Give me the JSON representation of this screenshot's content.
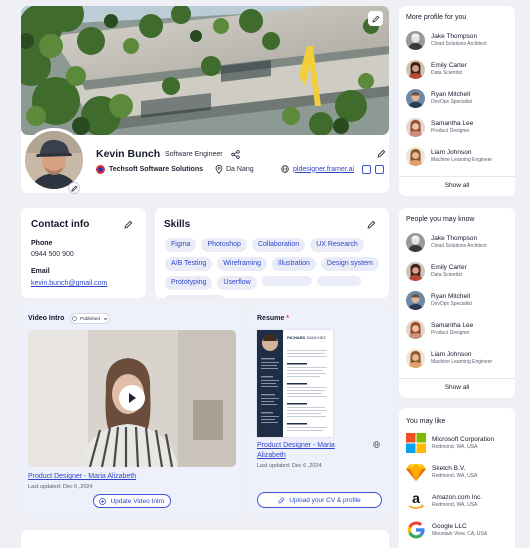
{
  "profile": {
    "name": "Kevin Bunch",
    "title": "Software Engineer",
    "company": "Techsoft Software Solutions",
    "location": "Da Nang",
    "website": "pldesigner.framer.ai"
  },
  "contact": {
    "heading": "Contact info",
    "phone_label": "Phone",
    "phone": "0944 500 900",
    "email_label": "Email",
    "email": "kevin.bunch@gmail.com"
  },
  "skills": {
    "heading": "Skills",
    "items": [
      "Figma",
      "Photoshop",
      "Collaboration",
      "UX Research",
      "A/B Testing",
      "Wireframing",
      "Illustration",
      "Design system",
      "Prototyping",
      "Userflow"
    ]
  },
  "video": {
    "heading": "Video Intro",
    "status": "Published",
    "title": "Product Designer - Maria Alizabeth",
    "updated": "Last updated: Dec 6 ,2024",
    "button": "Update Video Intro"
  },
  "resume": {
    "heading": "Resume",
    "required_mark": "*",
    "doc_first": "RICHARD",
    "doc_last": "SANCHEZ",
    "title": "Product Designer - Maria Alizabeth",
    "updated": "Last updated: Dec 6 ,2024",
    "button": "Upload your CV & profile"
  },
  "more_profiles": {
    "heading": "More profile for you",
    "people": [
      {
        "name": "Jake Thompson",
        "role": "Cloud Solutions Architect"
      },
      {
        "name": "Emily Carter",
        "role": "Data Scientist"
      },
      {
        "name": "Ryan Mitchell",
        "role": "DevOps Specialist"
      },
      {
        "name": "Samantha Lee",
        "role": "Product Designer"
      },
      {
        "name": "Liam Johnson",
        "role": "Machine Learning Engineer"
      }
    ],
    "show_all": "Show all"
  },
  "people_know": {
    "heading": "People you may know",
    "people": [
      {
        "name": "Jake Thompson",
        "role": "Cloud Solutions Architect"
      },
      {
        "name": "Emily Carter",
        "role": "Data Scientist"
      },
      {
        "name": "Ryan Mitchell",
        "role": "DevOps Specialist"
      },
      {
        "name": "Samantha Lee",
        "role": "Product Designer"
      },
      {
        "name": "Liam Johnson",
        "role": "Machine Learning Engineer"
      }
    ],
    "show_all": "Show all"
  },
  "you_may_like": {
    "heading": "You may like",
    "companies": [
      {
        "name": "Microsoft Corporation",
        "location": "Redmond, WA, USA",
        "logo": "microsoft-logo"
      },
      {
        "name": "Sketch B.V.",
        "location": "Redmond, WA, USA",
        "logo": "sketch-logo"
      },
      {
        "name": "Amazon.com Inc.",
        "location": "Redmond, WA, USA",
        "logo": "amazon-logo"
      },
      {
        "name": "Google LLC",
        "location": "Mountain View, CA, USA",
        "logo": "google-logo"
      }
    ]
  },
  "colors": {
    "accent": "#2f45c9",
    "chip_bg": "#eaedf8",
    "page_bg": "#eef0f5",
    "required": "#e0312f"
  }
}
